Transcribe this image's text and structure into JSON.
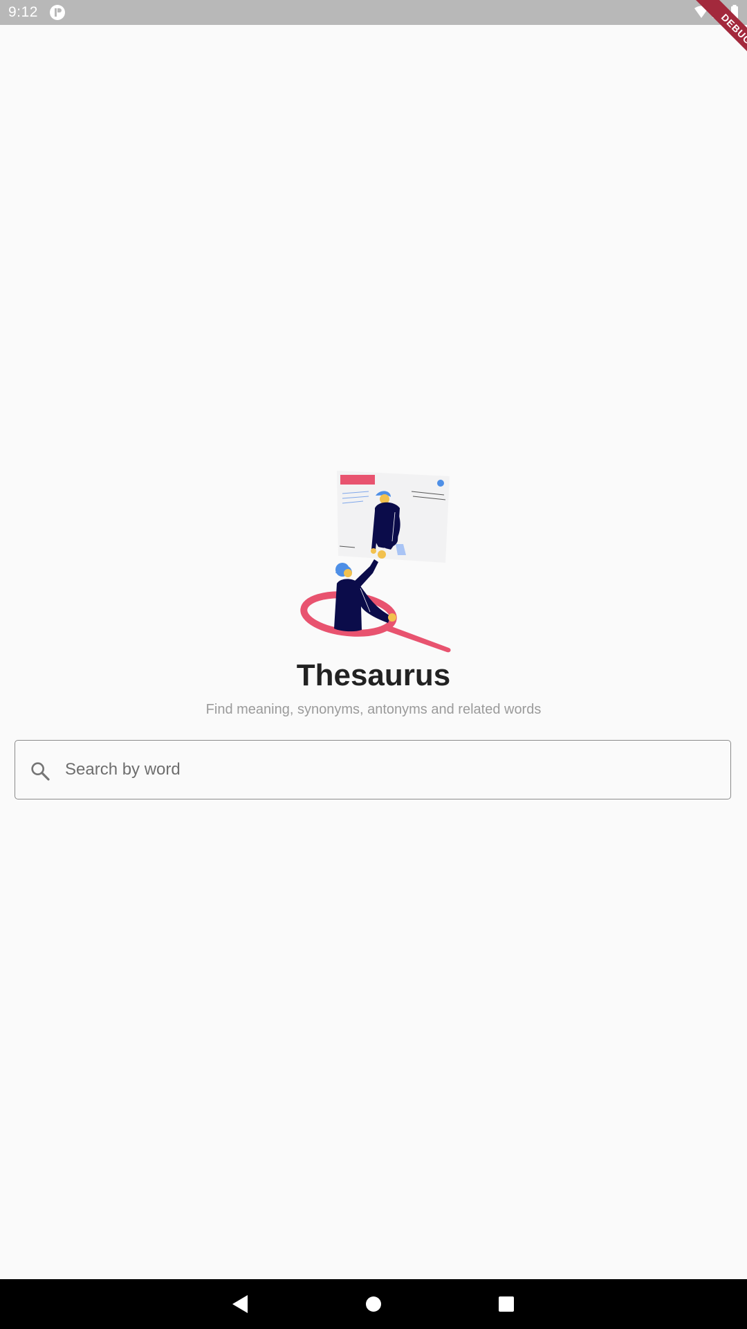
{
  "status_bar": {
    "time": "9:12",
    "icons": [
      "app-notification-icon",
      "wifi-icon",
      "cellular-signal-icon",
      "battery-icon"
    ]
  },
  "debug_banner": {
    "label": "DEBUG",
    "color": "#a3293c"
  },
  "illustration": {
    "name": "thesaurus-hero-illustration",
    "accent": "#e8536f",
    "figure": "#0b0c4a",
    "hair": "#4e8fe6",
    "skin": "#f2c14e"
  },
  "main": {
    "title": "Thesaurus",
    "subtitle": "Find meaning, synonyms, antonyms and related words"
  },
  "search": {
    "placeholder": "Search by word",
    "value": "",
    "icon": "search-icon"
  },
  "nav_bar": {
    "buttons": [
      "back-icon",
      "home-icon",
      "recents-icon"
    ]
  }
}
